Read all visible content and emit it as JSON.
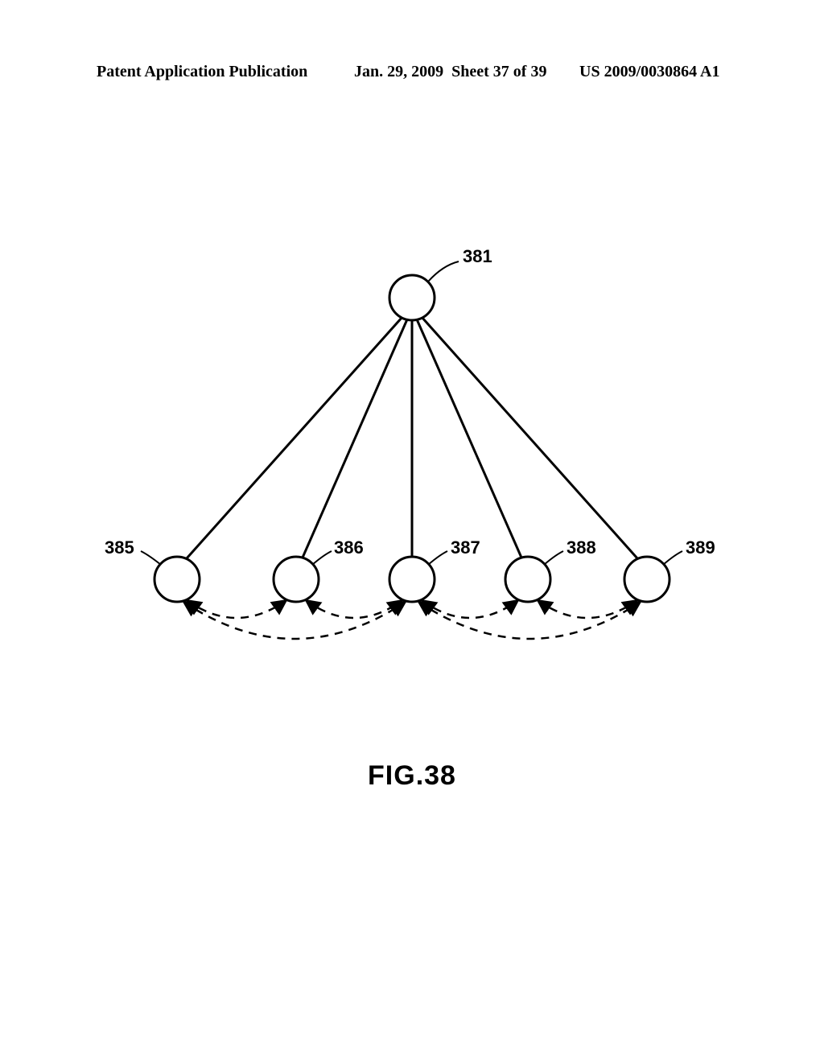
{
  "header": {
    "left": "Patent Application Publication",
    "date": "Jan. 29, 2009",
    "sheet": "Sheet 37 of 39",
    "pubno": "US 2009/0030864 A1"
  },
  "figure": {
    "label": "FIG.38"
  },
  "nodes": {
    "top": "381",
    "n1": "385",
    "n2": "386",
    "n3": "387",
    "n4": "388",
    "n5": "389"
  }
}
